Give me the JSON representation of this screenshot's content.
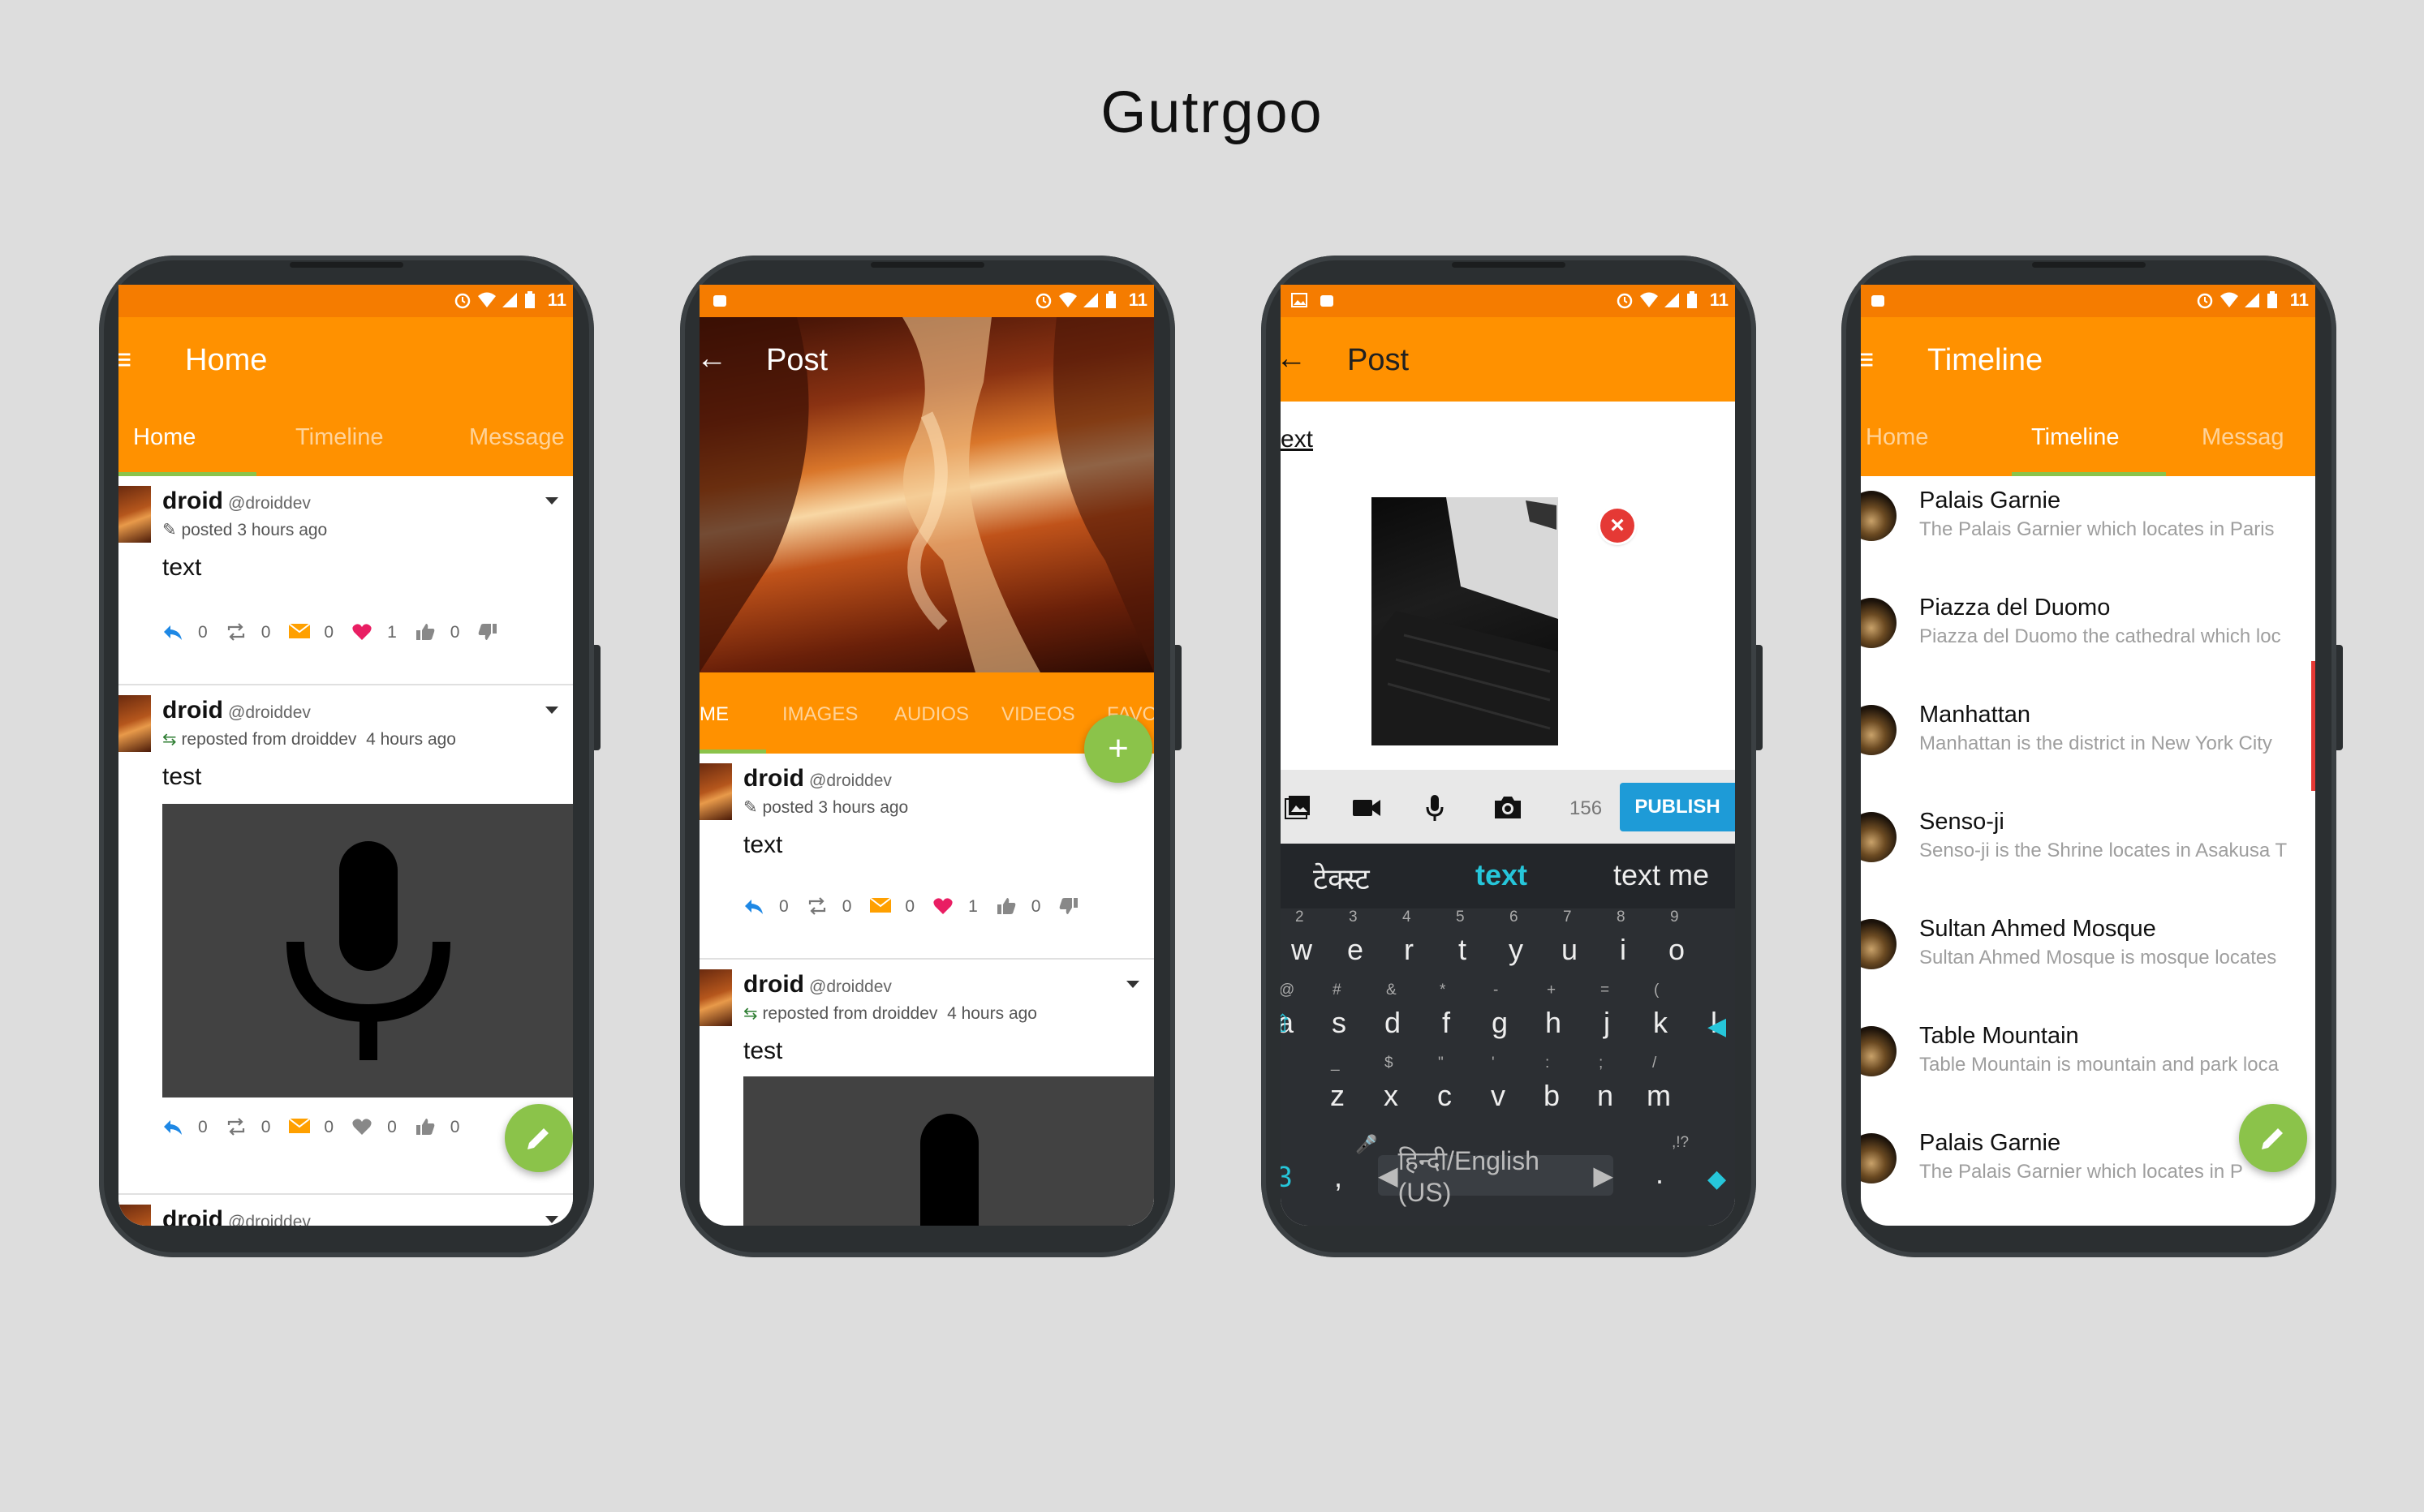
{
  "app_title": "Gutrgoo",
  "colors": {
    "status_bar": "#f57c00",
    "primary": "#ff9100",
    "accent": "#8bc34a",
    "publish": "#1e9bd7",
    "keyboard": "#2c2f33"
  },
  "status": {
    "time": "11"
  },
  "screen1": {
    "toolbar_title": "Home",
    "tabs": [
      "Home",
      "Timeline",
      "Message"
    ],
    "posts": [
      {
        "name": "droid",
        "handle": "@droiddev",
        "meta": "posted 3 hours ago",
        "text": "text",
        "counts": [
          "0",
          "0",
          "0",
          "1",
          "0"
        ]
      },
      {
        "name": "droid",
        "handle": "@droiddev",
        "meta": "reposted from droiddev",
        "meta_time": "4 hours ago",
        "text": "test",
        "counts": [
          "0",
          "0",
          "0",
          "0",
          "0"
        ]
      },
      {
        "name": "droid",
        "handle": "@droiddev"
      }
    ]
  },
  "screen2": {
    "toolbar_title": "Post",
    "tabs": [
      "ME",
      "IMAGES",
      "AUDIOS",
      "VIDEOS",
      "FAVO"
    ],
    "fab": "+",
    "posts": [
      {
        "name": "droid",
        "handle": "@droiddev",
        "meta": "posted 3 hours ago",
        "text": "text",
        "counts": [
          "0",
          "0",
          "0",
          "1",
          "0"
        ]
      },
      {
        "name": "droid",
        "handle": "@droiddev",
        "meta": "reposted from droiddev",
        "meta_time": "4 hours ago",
        "text": "test"
      }
    ]
  },
  "screen3": {
    "toolbar_title": "Post",
    "body_text": "ext",
    "char_count": "156",
    "publish_label": "PUBLISH",
    "suggestions": [
      "टेक्स्ट",
      "text",
      "text me"
    ],
    "row1": [
      [
        "w",
        "2"
      ],
      [
        "e",
        "3"
      ],
      [
        "r",
        "4"
      ],
      [
        "t",
        "5"
      ],
      [
        "y",
        "6"
      ],
      [
        "u",
        "7"
      ],
      [
        "i",
        "8"
      ],
      [
        "o",
        "9"
      ]
    ],
    "row2": [
      [
        "a",
        "@"
      ],
      [
        "s",
        "#"
      ],
      [
        "d",
        "&"
      ],
      [
        "f",
        "*"
      ],
      [
        "g",
        "-"
      ],
      [
        "h",
        "+"
      ],
      [
        "j",
        "="
      ],
      [
        "k",
        "("
      ],
      [
        "l",
        ""
      ]
    ],
    "row3": [
      [
        "z",
        "_"
      ],
      [
        "x",
        "$"
      ],
      [
        "c",
        "\""
      ],
      [
        "v",
        "'"
      ],
      [
        "b",
        ":"
      ],
      [
        "n",
        ";"
      ],
      [
        "m",
        "/"
      ]
    ],
    "space_label": "हिन्दी/English (US)",
    "left_key": "3",
    "punct_key": ".",
    "punct_hint": ",!?"
  },
  "screen4": {
    "toolbar_title": "Timeline",
    "tabs": [
      "Home",
      "Timeline",
      "Messag"
    ],
    "items": [
      {
        "title": "Palais Garnie",
        "sub": "The Palais Garnier which locates in Paris"
      },
      {
        "title": "Piazza del Duomo",
        "sub": "Piazza del Duomo the cathedral which loc"
      },
      {
        "title": "Manhattan",
        "sub": "Manhattan is the district in New York City"
      },
      {
        "title": "Senso-ji",
        "sub": "Senso-ji is the Shrine locates in Asakusa T"
      },
      {
        "title": "Sultan Ahmed Mosque",
        "sub": "Sultan Ahmed Mosque is mosque locates"
      },
      {
        "title": "Table Mountain",
        "sub": "Table Mountain is mountain and park loca"
      },
      {
        "title": "Palais Garnie",
        "sub": "The Palais Garnier which locates in P"
      }
    ]
  }
}
